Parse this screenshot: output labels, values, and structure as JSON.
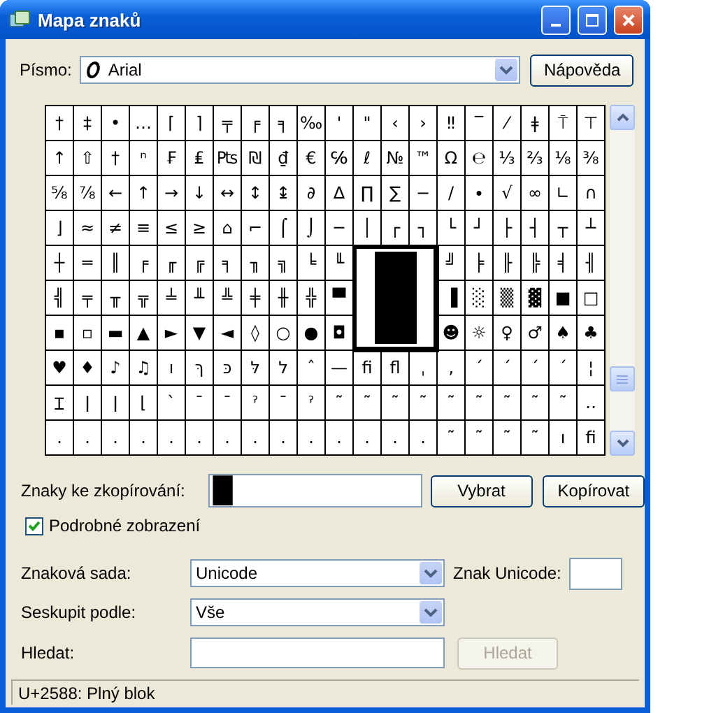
{
  "window": {
    "title": "Mapa znaků"
  },
  "font": {
    "label": "Písmo:",
    "value": "Arial"
  },
  "help_button": "Nápověda",
  "grid": {
    "rows": [
      [
        "†",
        "‡",
        "•",
        "…",
        "⌈",
        "⌉",
        "╤",
        "╒",
        "╕",
        "‰",
        "'",
        "\"",
        "‹",
        "›",
        "‼",
        "‾",
        "⁄",
        "ǂ",
        "⍑",
        "⊤"
      ],
      [
        "↑",
        "⇧",
        "†",
        "ⁿ",
        "₣",
        "₤",
        "₧",
        "₪",
        "₫",
        "€",
        "℅",
        "ℓ",
        "№",
        "™",
        "Ω",
        "℮",
        "⅓",
        "⅔",
        "⅛",
        "⅜"
      ],
      [
        "⅝",
        "⅞",
        "←",
        "↑",
        "→",
        "↓",
        "↔",
        "↕",
        "↨",
        "∂",
        "∆",
        "∏",
        "∑",
        "−",
        "∕",
        "∙",
        "√",
        "∞",
        "∟",
        "∩"
      ],
      [
        "⌋",
        "≈",
        "≠",
        "≡",
        "≤",
        "≥",
        "⌂",
        "⌐",
        "⌠",
        "⌡",
        "─",
        "│",
        "┌",
        "┐",
        "└",
        "┘",
        "├",
        "┤",
        "┬",
        "┴"
      ],
      [
        "┼",
        "═",
        "║",
        "╒",
        "╓",
        "╔",
        "╕",
        "╖",
        "╗",
        "╘",
        "╙",
        null,
        null,
        null,
        "╝",
        "╞",
        "╟",
        "╠",
        "╡",
        "╢"
      ],
      [
        "╣",
        "╤",
        "╥",
        "╦",
        "╧",
        "╨",
        "╩",
        "╪",
        "╫",
        "╬",
        "▀",
        null,
        null,
        null,
        "▐",
        "░",
        "▒",
        "▓",
        "■",
        "□"
      ],
      [
        "▪",
        "▫",
        "▬",
        "▲",
        "►",
        "▼",
        "◄",
        "◊",
        "○",
        "●",
        "◘",
        null,
        null,
        null,
        "☻",
        "☼",
        "♀",
        "♂",
        "♠",
        "♣"
      ],
      [
        "♥",
        "♦",
        "♪",
        "♫",
        "ו",
        "ךּ",
        "כּ",
        "לּ",
        "ל",
        "ˆ",
        "—",
        "ﬁ",
        "ﬂ",
        "ˌ",
        "‚",
        "ˊ",
        "ˊ",
        "ˊ",
        "ˊ",
        "¦"
      ],
      [
        "Ɪ",
        "ǀ",
        "ǀ",
        "⌊",
        "ˋ",
        "ˉ",
        "ˉ",
        "ˀ",
        "ˉ",
        "ˀ",
        "˜",
        "˜",
        "˜",
        "˜",
        "˜",
        "˜",
        "˜",
        "˜",
        "˜",
        "‥"
      ],
      [
        ".",
        ".",
        ".",
        ".",
        ".",
        ".",
        ".",
        ".",
        ".",
        ".",
        ".",
        ".",
        ".",
        ".",
        "˜",
        "˜",
        "˜",
        "˜",
        "ı",
        "ﬁ"
      ]
    ],
    "zoom_preview": {
      "kind": "block"
    }
  },
  "copy": {
    "label": "Znaky ke zkopírování:",
    "value": "█",
    "buttons": [
      "Vybrat",
      "Kopírovat"
    ]
  },
  "advanced_view": {
    "label": "Podrobné zobrazení",
    "checked": true
  },
  "character_set": {
    "label": "Znaková sada:",
    "value": "Unicode"
  },
  "unicode_char": {
    "label": "Znak Unicode:"
  },
  "group_by": {
    "label": "Seskupit podle:",
    "value": "Vše"
  },
  "search": {
    "label": "Hledat:",
    "button": {
      "label": "Hledat",
      "disabled": true
    }
  },
  "status_bar": "U+2588: Plný blok"
}
